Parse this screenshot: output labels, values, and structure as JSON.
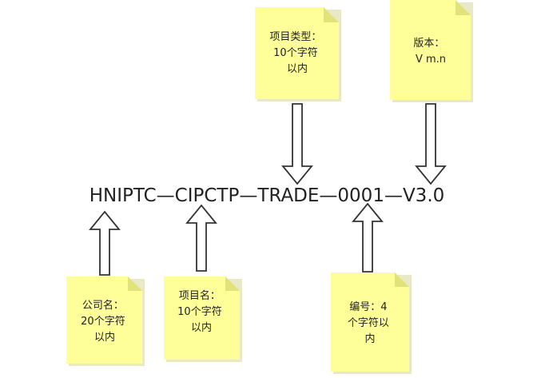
{
  "identifier": {
    "text": "HNIPTC—CIPCTP—TRADE—0001—V3.0"
  },
  "notes": {
    "project_type": [
      "项目类型：",
      "10个字符",
      "以内"
    ],
    "version": [
      "版本：",
      "V m.n"
    ],
    "company_name": [
      "公司名：",
      "20个字符",
      "以内"
    ],
    "project_name": [
      "项目名：",
      "10个字符",
      "以内"
    ],
    "serial_number": [
      "编号：4",
      "个字符以",
      "内"
    ]
  },
  "colors": {
    "note_fill": "#ffff99",
    "note_fold": "#e2e27a",
    "arrow_stroke": "#333333",
    "text": "#222222"
  }
}
